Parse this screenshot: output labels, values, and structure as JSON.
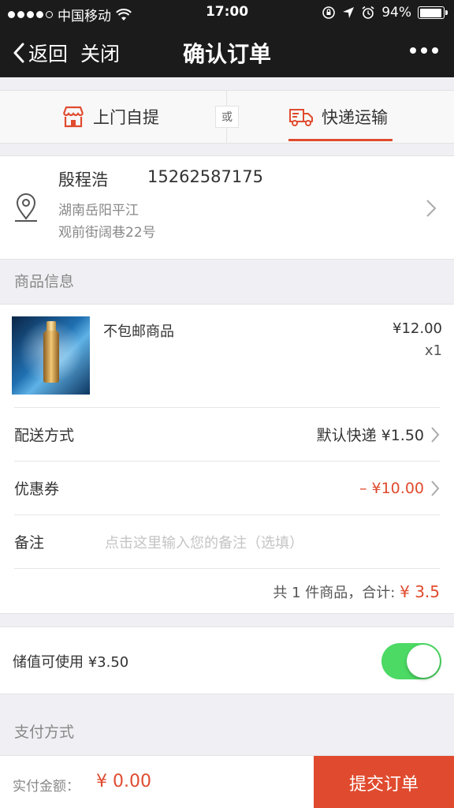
{
  "status_bar": {
    "carrier": "中国移动",
    "time": "17:00",
    "battery_text": "94%",
    "battery_level": 0.94
  },
  "nav": {
    "back_label": "返回",
    "close_label": "关闭",
    "title": "确认订单"
  },
  "delivery_tabs": {
    "pickup_label": "上门自提",
    "or_label": "或",
    "express_label": "快递运输",
    "active": "express"
  },
  "address": {
    "name": "殷程浩",
    "phone": "15262587175",
    "line1": "湖南岳阳平江",
    "line2": "观前街阔巷22号"
  },
  "goods_section": {
    "title": "商品信息",
    "item": {
      "name": "不包邮商品",
      "price": "¥12.00",
      "qty": "x1"
    },
    "shipping": {
      "label": "配送方式",
      "value": "默认快递 ¥1.50"
    },
    "coupon": {
      "label": "优惠券",
      "value": "– ¥10.00"
    },
    "remark": {
      "label": "备注",
      "placeholder": "点击这里输入您的备注（选填）"
    },
    "summary": {
      "text": "共 1 件商品，合计:",
      "total": "¥ 3.5"
    }
  },
  "stored_value": {
    "label": "储值可使用 ¥3.50",
    "enabled": true
  },
  "payment_section": {
    "title": "支付方式"
  },
  "bottom_bar": {
    "label": "实付金额：",
    "amount": "¥ 0.00",
    "submit_label": "提交订单"
  },
  "colors": {
    "accent": "#e04b2f",
    "toggle_on": "#4cd964",
    "nav_bg": "#1b1b1b"
  }
}
